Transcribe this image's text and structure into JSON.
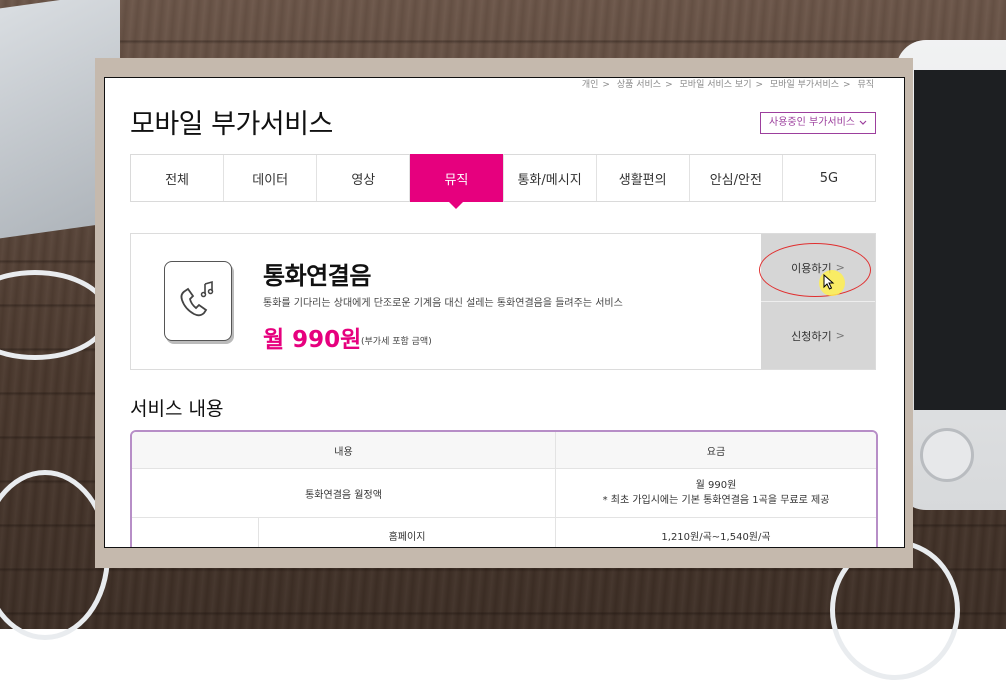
{
  "breadcrumb": [
    "개인",
    "상품 서비스",
    "모바일 서비스 보기",
    "모바일 부가서비스",
    "뮤직"
  ],
  "breadcrumb_sep": ">",
  "page_title": "모바일 부가서비스",
  "services_button": "사용중인 부가서비스",
  "tabs": [
    "전체",
    "데이터",
    "영상",
    "뮤직",
    "통화/메시지",
    "생활편의",
    "안심/안전",
    "5G"
  ],
  "active_tab": "뮤직",
  "service_card": {
    "name": "통화연결음",
    "description": "통화를 기다리는 상대에게 단조로운 기계음 대신 설레는 통화연결음을 들려주는 서비스",
    "price": "월 990원",
    "vat_note": "(부가세 포함 금액)",
    "use_button": "이용하기",
    "apply_button": "신청하기",
    "chevron": ">"
  },
  "section_title": "서비스 내용",
  "table": {
    "headers": [
      "내용",
      "요금"
    ],
    "rows": [
      {
        "content": "통화연결음 월정액",
        "fee_line1": "월 990원",
        "fee_line2": "* 최초 가입시에는 기본 통화연결음 1곡을 무료로 제공"
      },
      {
        "content": "홈페이지",
        "fee": "1,210원/곡~1,540원/곡"
      }
    ]
  },
  "colors": {
    "accent": "#e6007e",
    "brand_purple": "#9c3f9d",
    "highlight_ring": "#e03030"
  }
}
